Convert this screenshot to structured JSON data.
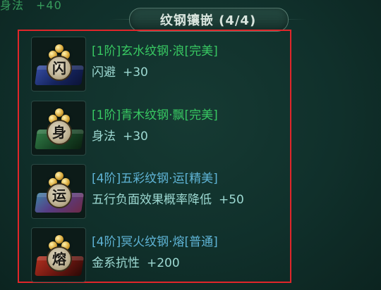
{
  "header": {
    "cut_text": "身法　+40",
    "title": "纹钢镶嵌 (4/4)"
  },
  "gems": [
    {
      "name": "[1阶]玄水纹钢·浪[完美]",
      "stat": "闪避",
      "value": "+30",
      "glyph": "闪",
      "name_color": "#38c862",
      "slab": "blue"
    },
    {
      "name": "[1阶]青木纹钢·飘[完美]",
      "stat": "身法",
      "value": "+30",
      "glyph": "身",
      "name_color": "#38c862",
      "slab": "green"
    },
    {
      "name": "[4阶]五彩纹钢·运[精美]",
      "stat": "五行负面效果概率降低",
      "value": "+50",
      "glyph": "运",
      "name_color": "#5fb4d6",
      "slab": "multi"
    },
    {
      "name": "[4阶]冥火纹钢·熔[普通]",
      "stat": "金系抗性",
      "value": "+200",
      "glyph": "熔",
      "name_color": "#5fb4d6",
      "slab": "red"
    }
  ],
  "colors": {
    "highlight_frame": "#e0262a",
    "background": "#10302b"
  }
}
